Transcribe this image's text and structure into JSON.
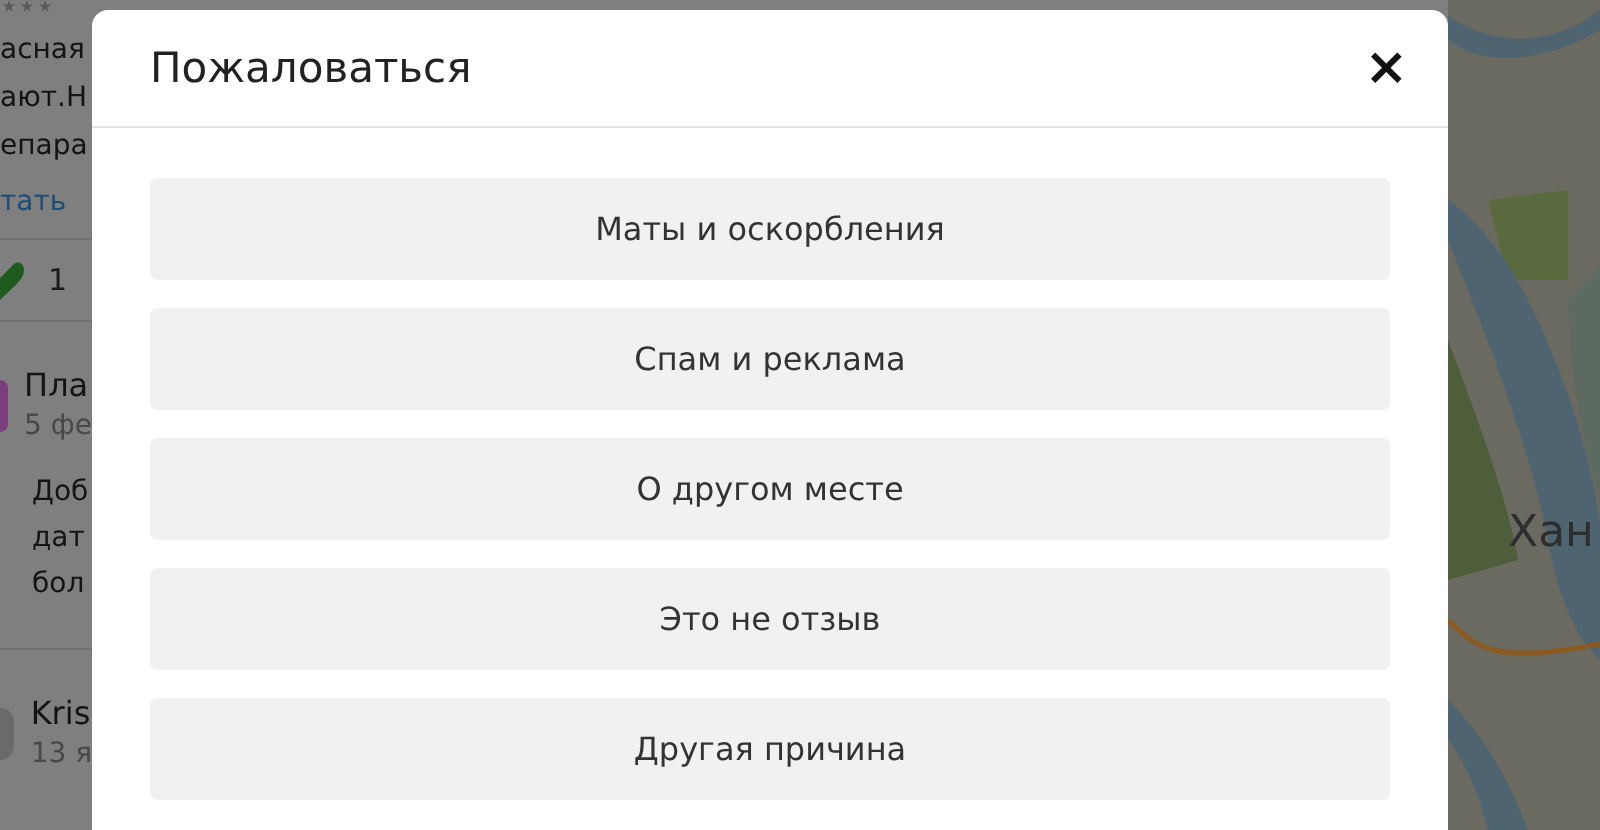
{
  "review": {
    "text_lines": [
      "асная",
      "ают.Н",
      "епара"
    ],
    "link": "тать",
    "likes": "1"
  },
  "comments": [
    {
      "author": "Пла",
      "date": "5 фе",
      "text_lines": [
        "Доб",
        "дат",
        "бол"
      ],
      "color": "#7a3f7c"
    },
    {
      "author": "Kris",
      "date": "13 я",
      "color": "#6a6a6a"
    }
  ],
  "map": {
    "label": "Хан"
  },
  "dialog": {
    "title": "Пожаловаться",
    "close": "×",
    "options": [
      "Маты и оскорбления",
      "Спам и реклама",
      "О другом месте",
      "Это не отзыв",
      "Другая причина"
    ]
  }
}
